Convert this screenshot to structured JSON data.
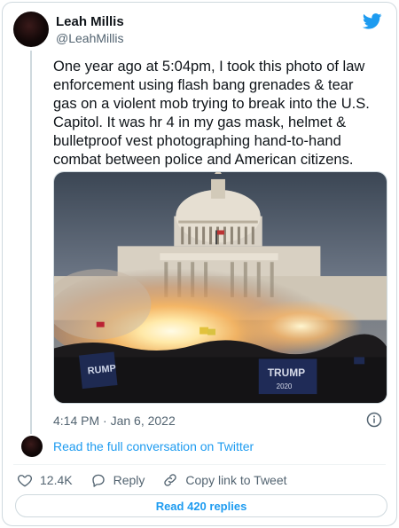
{
  "author": {
    "name": "Leah Millis",
    "handle": "@LeahMillis",
    "avatar_icon": "profile-avatar"
  },
  "brand": {
    "icon": "twitter-bird-icon",
    "color": "#1d9bf0"
  },
  "tweet": {
    "text_lines": [
      "One year ago at 5:04pm, I took this photo of law",
      "enforcement using flash bang grenades & tear",
      "gas on a violent mob trying to break into the U.S.",
      "Capitol. It was hr 4 in my gas mask, helmet &",
      "bulletproof vest photographing hand-to-hand",
      "combat between police and American citizens."
    ],
    "timestamp": "4:14 PM · Jan 6, 2022",
    "banner_texts": [
      "RUMP",
      "TRUMP",
      "2020"
    ]
  },
  "conversation_link": "Read the full conversation on Twitter",
  "actions": {
    "likes": "12.4K",
    "reply_label": "Reply",
    "copy_label": "Copy link to Tweet"
  },
  "replies_button": "Read 420 replies",
  "icons": {
    "info": "info-icon",
    "like": "heart-icon",
    "reply": "reply-icon",
    "copy": "link-icon"
  }
}
